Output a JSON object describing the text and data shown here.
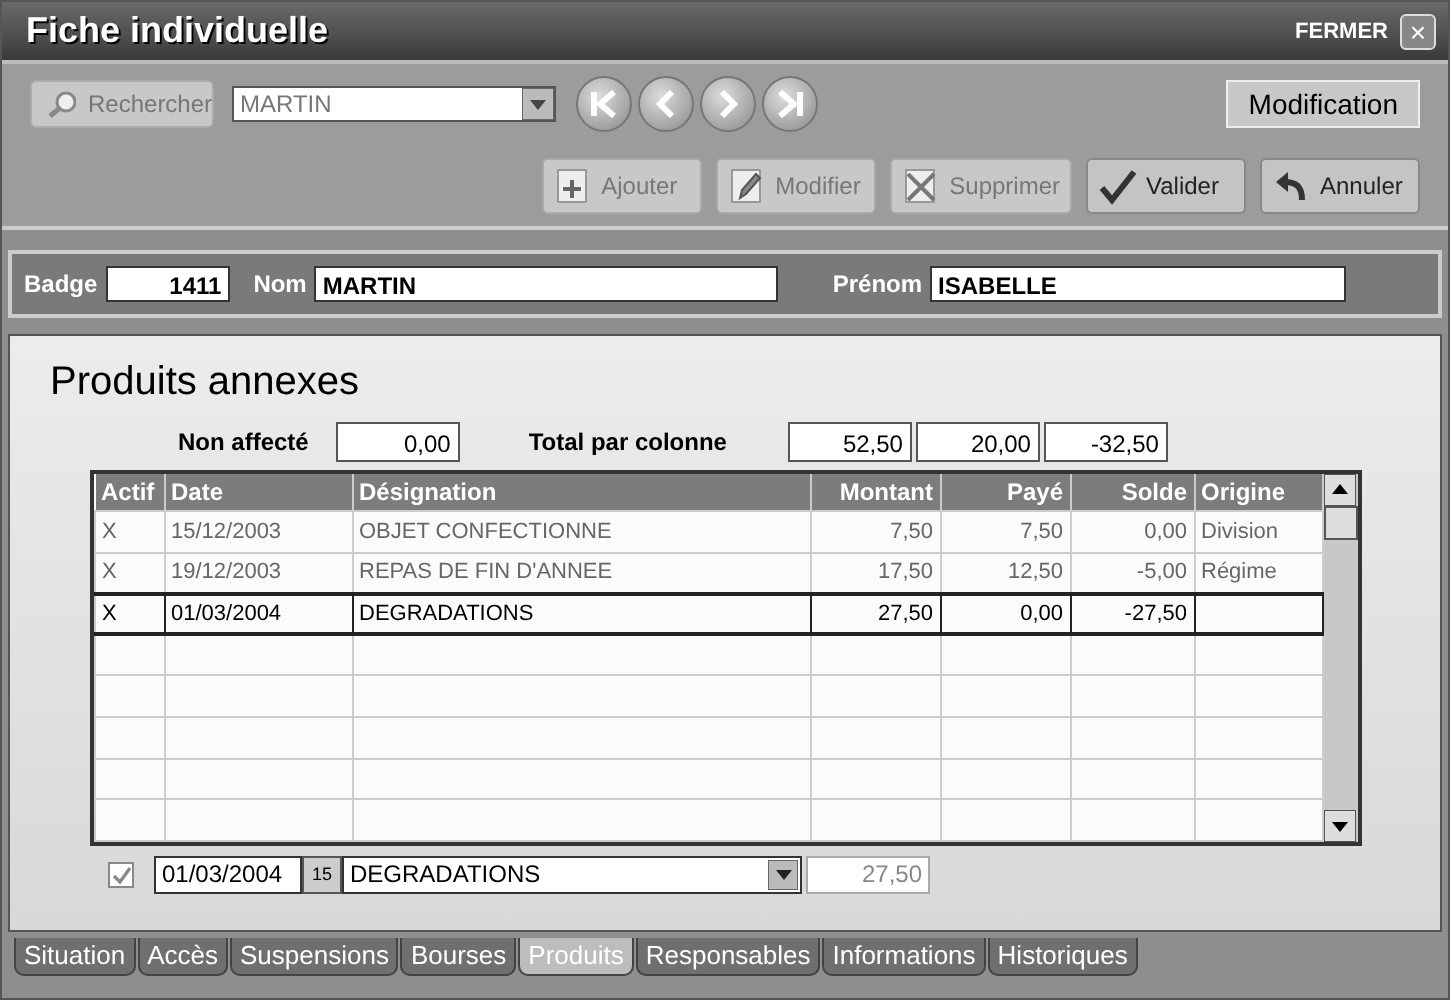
{
  "window": {
    "title": "Fiche individuelle",
    "close_label": "FERMER",
    "close_button": "×"
  },
  "toolbar": {
    "search_button": {
      "label": "Rechercher",
      "disabled": true
    },
    "search_combo": {
      "value": "MARTIN"
    },
    "nav_buttons": [
      {
        "kind": "first"
      },
      {
        "kind": "prev"
      },
      {
        "kind": "next"
      },
      {
        "kind": "last"
      }
    ],
    "mode": "Modification",
    "actions": [
      {
        "label": "Ajouter",
        "kind": "add",
        "disabled": true
      },
      {
        "label": "Modifier",
        "kind": "edit",
        "disabled": true
      },
      {
        "label": "Supprimer",
        "kind": "delete",
        "disabled": true
      },
      {
        "label": "Valider",
        "kind": "ok",
        "disabled": false
      },
      {
        "label": "Annuler",
        "kind": "cancel",
        "disabled": false
      }
    ]
  },
  "identity": {
    "badge_label": "Badge",
    "badge": "1411",
    "nom_label": "Nom",
    "nom": "MARTIN",
    "prenom_label": "Prénom",
    "prenom": "ISABELLE"
  },
  "section_title": "Produits annexes",
  "totals": {
    "non_affecte_label": "Non affecté",
    "non_affecte": "0,00",
    "total_label": "Total par colonne",
    "values": [
      "52,50",
      "20,00",
      "-32,50"
    ]
  },
  "table": {
    "columns": [
      "Actif",
      "Date",
      "Désignation",
      "Montant",
      "Payé",
      "Solde",
      "Origine"
    ],
    "rows": [
      {
        "cells": [
          "X",
          "15/12/2003",
          "OBJET CONFECTIONNE",
          "7,50",
          "7,50",
          "0,00",
          "Division"
        ],
        "selected": false
      },
      {
        "cells": [
          "X",
          "19/12/2003",
          "REPAS DE FIN D'ANNEE",
          "17,50",
          "12,50",
          "-5,00",
          "Régime"
        ],
        "selected": false
      },
      {
        "cells": [
          "X",
          "01/03/2004",
          "DEGRADATIONS",
          "27,50",
          "0,00",
          "-27,50",
          ""
        ],
        "selected": true
      }
    ]
  },
  "edit_row": {
    "checked": true,
    "date": "01/03/2004",
    "calendar_button": "15",
    "designation": "DEGRADATIONS",
    "montant": "27,50"
  },
  "tabs": [
    {
      "label": "Situation",
      "selected": false
    },
    {
      "label": "Accès",
      "selected": false
    },
    {
      "label": "Suspensions",
      "selected": false
    },
    {
      "label": "Bourses",
      "selected": false
    },
    {
      "label": "Produits",
      "selected": true
    },
    {
      "label": "Responsables",
      "selected": false
    },
    {
      "label": "Informations",
      "selected": false
    },
    {
      "label": "Historiques",
      "selected": false
    }
  ]
}
